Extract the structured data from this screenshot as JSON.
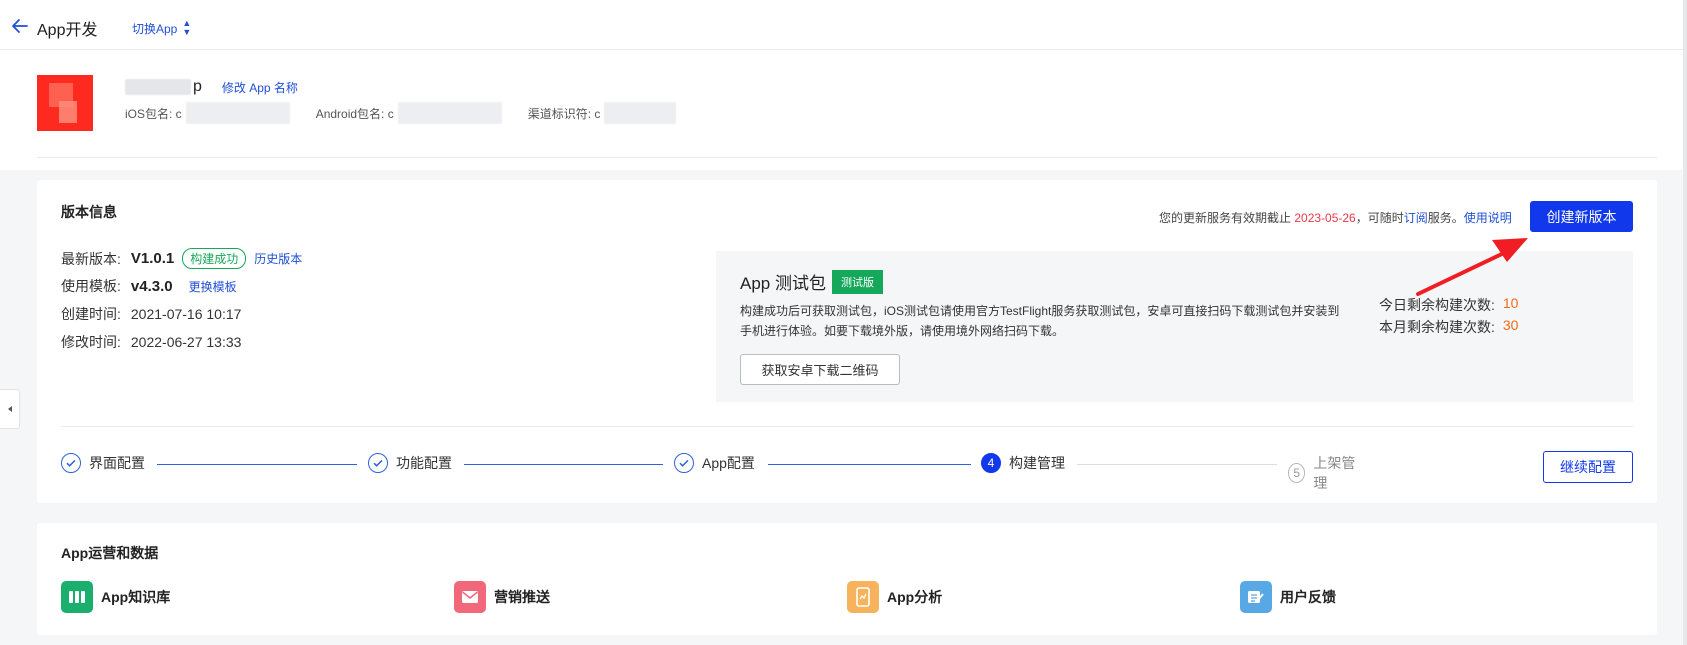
{
  "topbar": {
    "title": "App开发",
    "switch_label": "切换App",
    "back_icon": "arrow-left-icon"
  },
  "app": {
    "name_visible": "p",
    "rename_label": "修改 App 名称",
    "ios_label": "iOS包名: c",
    "android_label": "Android包名: c",
    "channel_label": "渠道标识符: c"
  },
  "version_card": {
    "title": "版本信息",
    "notice_prefix": "您的更新服务有效期截止 ",
    "notice_date": "2023-05-26",
    "notice_mid": "，可随时",
    "notice_subscribe": "订阅",
    "notice_suffix": "服务。",
    "notice_help": "使用说明",
    "create_button": "创建新版本",
    "latest_label": "最新版本:",
    "latest_value": "V1.0.1",
    "build_status": "构建成功",
    "history_link": "历史版本",
    "template_label": "使用模板:",
    "template_value": "v4.3.0",
    "change_template": "更换模板",
    "created_label": "创建时间:",
    "created_value": "2021-07-16 10:17",
    "modified_label": "修改时间:",
    "modified_value": "2022-06-27 13:33"
  },
  "test_package": {
    "title": "App 测试包",
    "badge": "测试版",
    "desc": "构建成功后可获取测试包，iOS测试包请使用官方TestFlight服务获取测试包，安卓可直接扫码下载测试包并安装到手机进行体验。如要下载境外版，请使用境外网络扫码下载。",
    "qr_button": "获取安卓下载二维码",
    "today_label": "今日剩余构建次数:",
    "today_value": "10",
    "month_label": "本月剩余构建次数:",
    "month_value": "30"
  },
  "steps": [
    {
      "label": "界面配置",
      "state": "done"
    },
    {
      "label": "功能配置",
      "state": "done"
    },
    {
      "label": "App配置",
      "state": "done"
    },
    {
      "label": "构建管理",
      "state": "active",
      "index": "4"
    },
    {
      "label": "上架管理",
      "state": "todo",
      "index": "5"
    }
  ],
  "continue_button": "继续配置",
  "ops": {
    "title": "App运营和数据",
    "items": [
      {
        "label": "App知识库",
        "color": "#1aaf6c"
      },
      {
        "label": "营销推送",
        "color": "#f0687a"
      },
      {
        "label": "App分析",
        "color": "#f7b35b"
      },
      {
        "label": "用户反馈",
        "color": "#58a8e6"
      }
    ]
  },
  "colors": {
    "primary": "#1238ec",
    "success": "#15a85a",
    "danger": "#e8394a",
    "warning": "#f26a16",
    "annotation_arrow": "#f01e24"
  }
}
